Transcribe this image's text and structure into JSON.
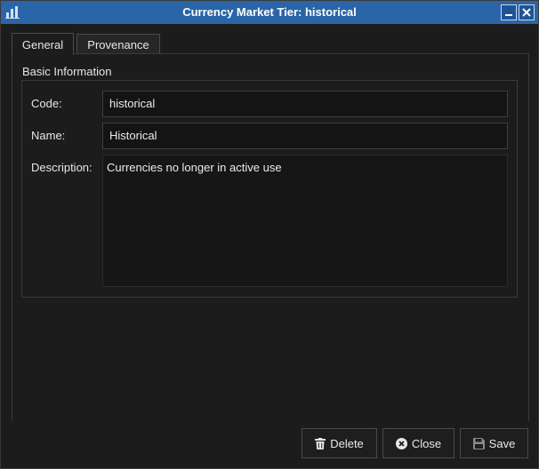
{
  "window": {
    "title": "Currency Market Tier: historical",
    "app_icon": "bar-chart-icon",
    "controls": [
      "minimize-icon",
      "close-icon"
    ]
  },
  "tabs": [
    {
      "label": "General",
      "active": true
    },
    {
      "label": "Provenance",
      "active": false
    }
  ],
  "group": {
    "title": "Basic Information"
  },
  "form": {
    "code_label": "Code:",
    "code_value": "historical",
    "name_label": "Name:",
    "name_value": "Historical",
    "description_label": "Description:",
    "description_value": "Currencies no longer in active use"
  },
  "buttons": {
    "delete_label": "Delete",
    "delete_icon": "trash-icon",
    "close_label": "Close",
    "close_icon": "close-circle-icon",
    "save_label": "Save",
    "save_icon": "floppy-icon"
  },
  "colors": {
    "titlebar": "#2a65a8",
    "background": "#1c1c1c",
    "field_background": "#141414"
  }
}
